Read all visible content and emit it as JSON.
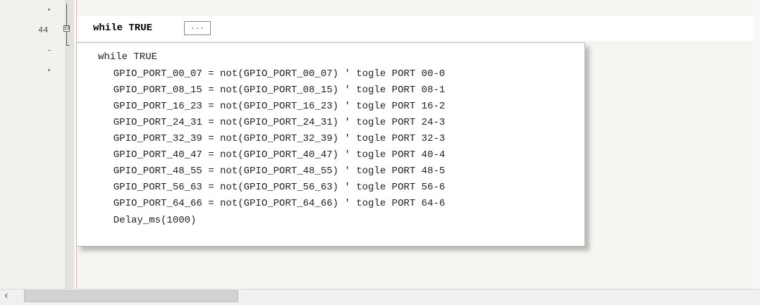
{
  "editor": {
    "line_number": "44",
    "fold_symbol": "⊟",
    "current_code": "while TRUE",
    "collapsed_marker": "..."
  },
  "popup": {
    "lines": [
      "while TRUE",
      "  GPIO_PORT_00_07 = not(GPIO_PORT_00_07) ' togle PORT 00-0",
      "  GPIO_PORT_08_15 = not(GPIO_PORT_08_15) ' togle PORT 08-1",
      "  GPIO_PORT_16_23 = not(GPIO_PORT_16_23) ' togle PORT 16-2",
      "  GPIO_PORT_24_31 = not(GPIO_PORT_24_31) ' togle PORT 24-3",
      "  GPIO_PORT_32_39 = not(GPIO_PORT_32_39) ' togle PORT 32-3",
      "  GPIO_PORT_40_47 = not(GPIO_PORT_40_47) ' togle PORT 40-4",
      "  GPIO_PORT_48_55 = not(GPIO_PORT_48_55) ' togle PORT 48-5",
      "  GPIO_PORT_56_63 = not(GPIO_PORT_56_63) ' togle PORT 56-6",
      "  GPIO_PORT_64_66 = not(GPIO_PORT_64_66) ' togle PORT 64-6",
      "  Delay_ms(1000)"
    ]
  },
  "scrollbar": {
    "left_arrow": "‹"
  }
}
